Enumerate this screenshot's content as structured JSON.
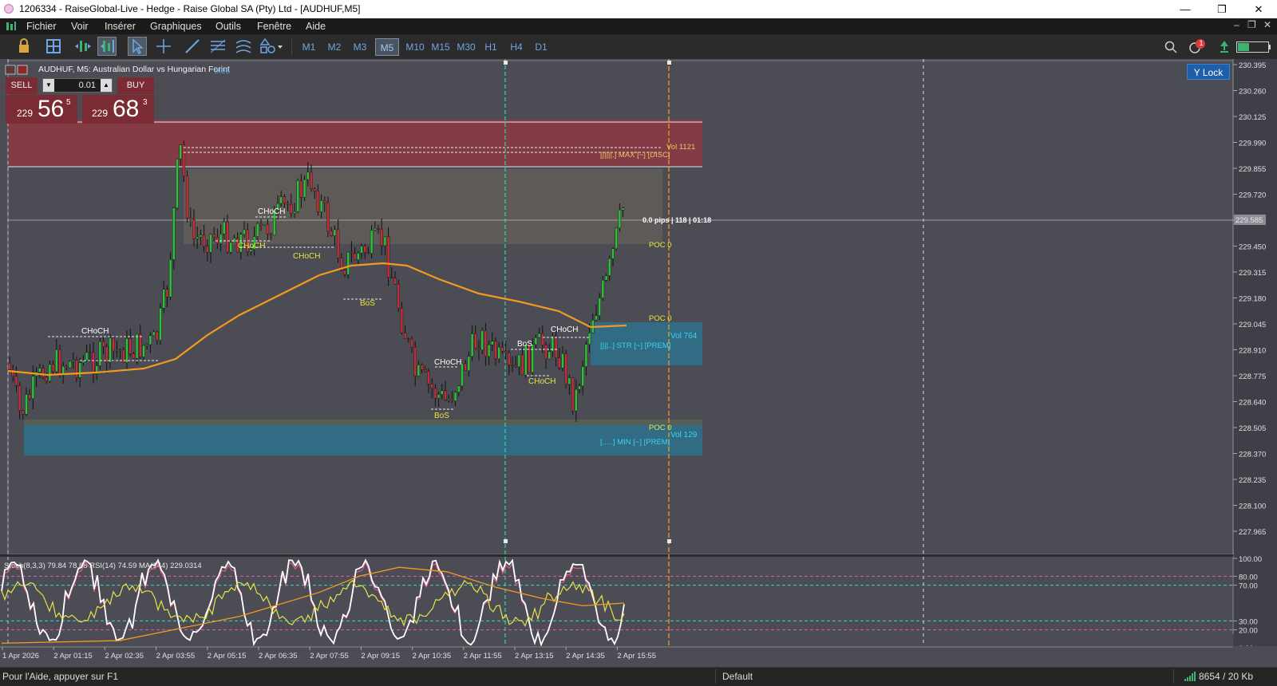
{
  "window": {
    "title": "1206334 - RaiseGlobal-Live - Hedge - Raise Global SA (Pty) Ltd - [AUDHUF,M5]",
    "controls": [
      "—",
      "❐",
      "✕"
    ]
  },
  "menu": [
    "Fichier",
    "Voir",
    "Insérer",
    "Graphiques",
    "Outils",
    "Fenêtre",
    "Aide"
  ],
  "toolbar": {
    "tools": [
      "lock-icon",
      "layout-grid-icon",
      "chart-autoscroll-icon",
      "chart-shift-icon",
      "cursor-icon",
      "crosshair-icon",
      "trendline-icon",
      "fibonacci-icon",
      "channel-icon",
      "shapes-icon"
    ],
    "timeframes": [
      "M1",
      "M2",
      "M3",
      "M5",
      "M10",
      "M15",
      "M30",
      "H1",
      "H4",
      "D1"
    ],
    "active_timeframe": "M5",
    "notification_count": "1",
    "accent": "#6fa6e6"
  },
  "chart": {
    "header": "AUDHUF, M5:  Australian Dollar vs Hungarian Forint",
    "header_overlay": "bles",
    "y_lock_label": "Y Lock",
    "trade": {
      "sell_label": "SELL",
      "buy_label": "BUY",
      "lot": "0.01",
      "sell_prefix": "229",
      "sell_big": "56",
      "sell_sup": "5",
      "buy_prefix": "229",
      "buy_big": "68",
      "buy_sup": "3"
    },
    "price_axis": [
      "230.395",
      "230.260",
      "230.125",
      "229.990",
      "229.855",
      "229.720",
      "229.585",
      "229.450",
      "229.315",
      "229.180",
      "229.045",
      "228.910",
      "228.775",
      "228.640",
      "228.505",
      "228.370",
      "228.235",
      "228.100",
      "227.965"
    ],
    "current_price_label": "229.585",
    "info_line": "0.0 pips | 118 | 01:18",
    "zone_labels": {
      "top_vol": "Vol 1121",
      "top_line": "[|||||.] MAX [~] [DISC]",
      "mid_vol": "Vol 764",
      "mid_line": "[|||..] STR [~] [PREM]",
      "low_vol": "Vol 129",
      "low_line": "[.....] MIN [~] [PREM]",
      "poc_labels": [
        "POC 0",
        "POC 0",
        "POC 0"
      ]
    },
    "structure_labels": [
      {
        "text": "CHoCH",
        "color": "#ffffff"
      },
      {
        "text": "CHoCH",
        "color": "#ffffff"
      },
      {
        "text": "CHoCH",
        "color": "#e8e63c"
      },
      {
        "text": "CHoCH",
        "color": "#e8e63c"
      },
      {
        "text": "BoS",
        "color": "#e8e63c"
      },
      {
        "text": "CHoCH",
        "color": "#ffffff"
      },
      {
        "text": "BoS",
        "color": "#e8e63c"
      },
      {
        "text": "BoS",
        "color": "#ffffff"
      },
      {
        "text": "CHoCH",
        "color": "#e8e63c"
      },
      {
        "text": "CHoCH",
        "color": "#ffffff"
      }
    ],
    "indicator_label": "Stoch(8,3,3) 79.84 78.88 RSI(14) 74.59 MA(144) 229.0314",
    "indicator_axis": [
      "100.00",
      "80.00",
      "70.00",
      "30.00",
      "20.00",
      "0.00"
    ],
    "time_axis": [
      "1 Apr 2026",
      "2 Apr 01:15",
      "2 Apr 02:35",
      "2 Apr 03:55",
      "2 Apr 05:15",
      "2 Apr 06:35",
      "2 Apr 07:55",
      "2 Apr 09:15",
      "2 Apr 10:35",
      "2 Apr 11:55",
      "2 Apr 13:15",
      "2 Apr 14:35",
      "2 Apr 15:55"
    ],
    "colors": {
      "background": "#4c4c55",
      "bull": "#2fbf3a",
      "bear": "#c0303a",
      "ma": "#f39a1e",
      "supply_zone": "#8a3a44",
      "demand_zone": "#2f6f8a",
      "stoch_main": "#ffffff",
      "rsi": "#e6e24a"
    }
  },
  "status": {
    "help": "Pour l'Aide, appuyer sur F1",
    "profile": "Default",
    "traffic": "8654 / 20 Kb"
  }
}
